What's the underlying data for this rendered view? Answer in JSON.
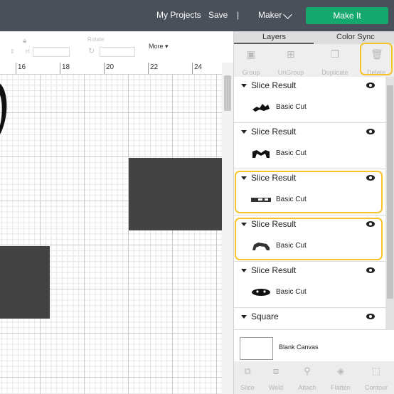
{
  "header": {
    "my_projects": "My Projects",
    "save": "Save",
    "separator": "|",
    "machine": "Maker",
    "make_it": "Make It"
  },
  "editbar": {
    "h_label": "H",
    "rotate_label": "Rotate",
    "more_label": "More"
  },
  "ruler": {
    "labels": [
      "16",
      "18",
      "20",
      "22",
      "24"
    ]
  },
  "panel": {
    "tabs": [
      "Layers",
      "Color Sync"
    ],
    "top_tools": [
      "Group",
      "UnGroup",
      "Duplicate",
      "Delete"
    ],
    "layers": [
      {
        "title": "Slice Result",
        "sub": "Basic Cut",
        "highlighted": false
      },
      {
        "title": "Slice Result",
        "sub": "Basic Cut",
        "highlighted": false
      },
      {
        "title": "Slice Result",
        "sub": "Basic Cut",
        "highlighted": true
      },
      {
        "title": "Slice Result",
        "sub": "Basic Cut",
        "highlighted": true
      },
      {
        "title": "Slice Result",
        "sub": "Basic Cut",
        "highlighted": false
      },
      {
        "title": "Square"
      }
    ],
    "blank_canvas": "Blank Canvas",
    "bottom_tools": [
      "Slice",
      "Weld",
      "Attach",
      "Flatten",
      "Contour"
    ]
  },
  "colors": {
    "topbar": "#4a5059",
    "make_it": "#14a86e",
    "highlight": "#f6c328",
    "shape": "#434343"
  }
}
